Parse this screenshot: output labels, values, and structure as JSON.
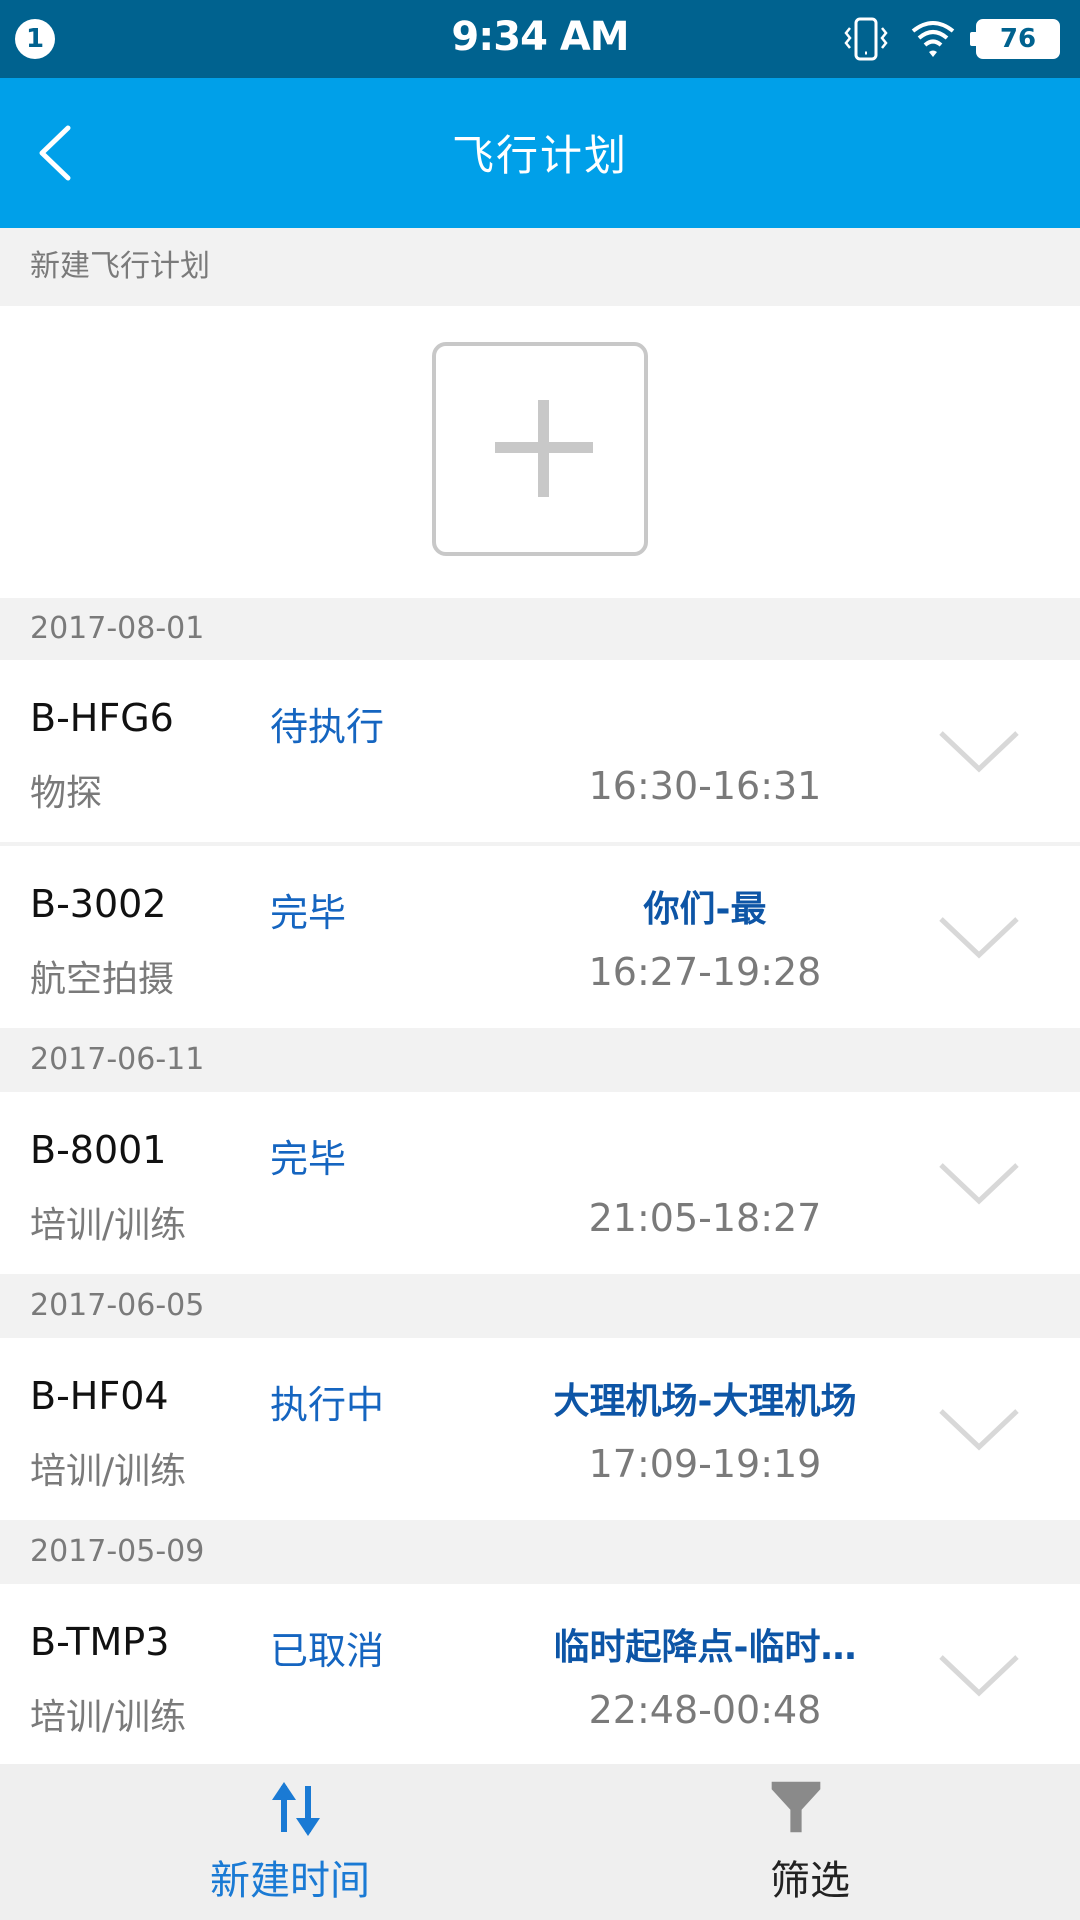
{
  "status_bar": {
    "notification_count": "1",
    "time": "9:34 AM",
    "battery": "76"
  },
  "header": {
    "title": "飞行计划"
  },
  "new_plan": {
    "section_label": "新建飞行计划"
  },
  "groups": [
    {
      "date": "2017-08-01",
      "items": [
        {
          "registration": "B-HFG6",
          "status": "待执行",
          "route": "",
          "type": "物探",
          "time": "16:30-16:31"
        },
        {
          "registration": "B-3002",
          "status": "完毕",
          "route": "你们-最",
          "type": "航空拍摄",
          "time": "16:27-19:28"
        }
      ]
    },
    {
      "date": "2017-06-11",
      "items": [
        {
          "registration": "B-8001",
          "status": "完毕",
          "route": "",
          "type": "培训/训练",
          "time": "21:05-18:27"
        }
      ]
    },
    {
      "date": "2017-06-05",
      "items": [
        {
          "registration": "B-HF04",
          "status": "执行中",
          "route": "大理机场-大理机场",
          "type": "培训/训练",
          "time": "17:09-19:19"
        }
      ]
    },
    {
      "date": "2017-05-09",
      "items": [
        {
          "registration": "B-TMP3",
          "status": "已取消",
          "route": "临时起降点-临时…",
          "type": "培训/训练",
          "time": "22:48-00:48"
        }
      ]
    }
  ],
  "bottom_bar": {
    "sort_label": "新建时间",
    "filter_label": "筛选"
  },
  "colors": {
    "status_bar": "#00628f",
    "app_bar": "#00a0e9",
    "status_text": "#1565c0",
    "route_text": "#0d55a6",
    "active_tab": "#1a7ad4"
  }
}
